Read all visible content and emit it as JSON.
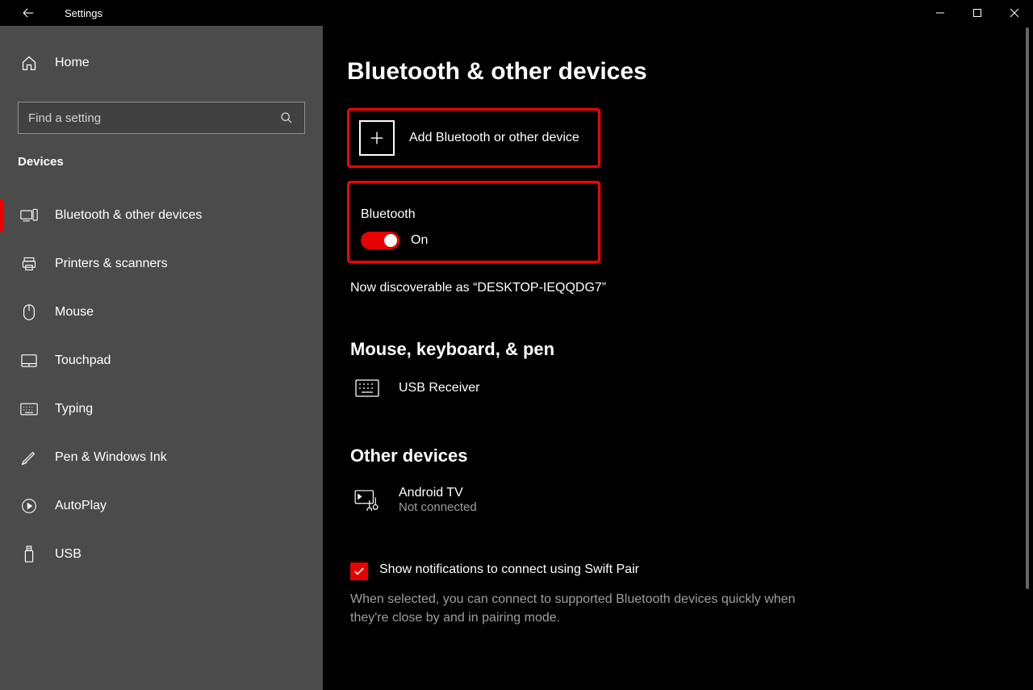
{
  "app_title": "Settings",
  "home_label": "Home",
  "search": {
    "placeholder": "Find a setting"
  },
  "category": "Devices",
  "nav": [
    {
      "label": "Bluetooth & other devices",
      "active": true
    },
    {
      "label": "Printers & scanners"
    },
    {
      "label": "Mouse"
    },
    {
      "label": "Touchpad"
    },
    {
      "label": "Typing"
    },
    {
      "label": "Pen & Windows Ink"
    },
    {
      "label": "AutoPlay"
    },
    {
      "label": "USB"
    }
  ],
  "page_title": "Bluetooth & other devices",
  "add_device_label": "Add Bluetooth or other device",
  "bluetooth": {
    "label": "Bluetooth",
    "state_label": "On"
  },
  "discoverable_text": "Now discoverable as “DESKTOP-IEQQDG7”",
  "section_mouse": "Mouse, keyboard, & pen",
  "device_usb": {
    "name": "USB Receiver"
  },
  "section_other": "Other devices",
  "device_tv": {
    "name": "Android TV",
    "status": "Not connected"
  },
  "swift_pair": {
    "label": "Show notifications to connect using Swift Pair",
    "desc": "When selected, you can connect to supported Bluetooth devices quickly when they're close by and in pairing mode."
  }
}
